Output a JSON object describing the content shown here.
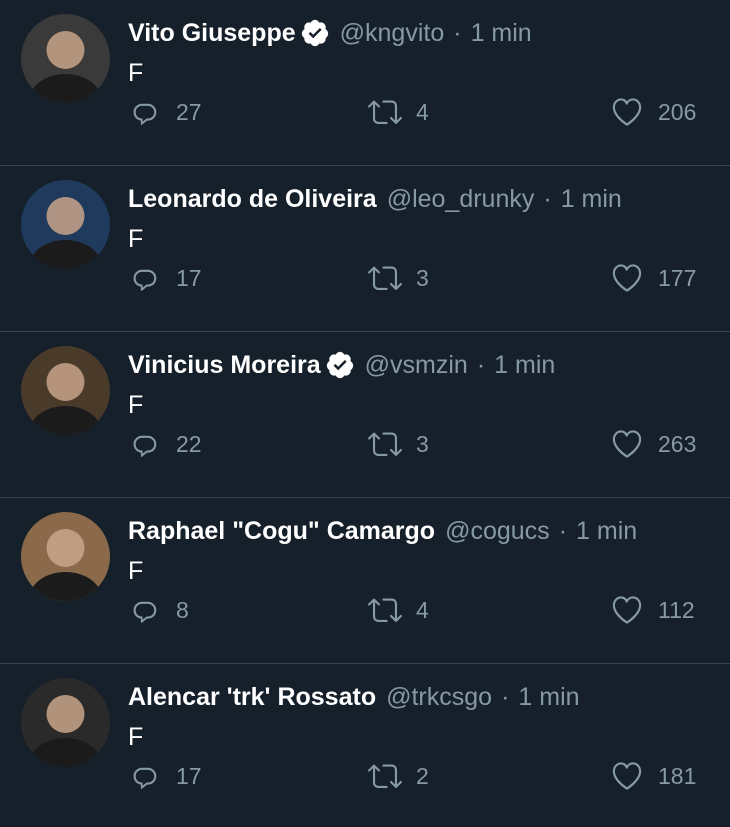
{
  "colors": {
    "background": "#15202b",
    "divider": "#38444d",
    "secondary_text": "#8899a6",
    "primary_text": "#ffffff"
  },
  "tweets": [
    {
      "display_name": "Vito Giuseppe",
      "verified": true,
      "handle": "@kngvito",
      "separator": "·",
      "time": "1 min",
      "text": "F",
      "replies": "27",
      "retweets": "4",
      "likes": "206",
      "avatar_tone": "#3a3a3a"
    },
    {
      "display_name": "Leonardo de Oliveira",
      "verified": false,
      "handle": "@leo_drunky",
      "separator": "·",
      "time": "1 min",
      "text": "F",
      "replies": "17",
      "retweets": "3",
      "likes": "177",
      "avatar_tone": "#1f3a5c"
    },
    {
      "display_name": "Vinicius Moreira",
      "verified": true,
      "handle": "@vsmzin",
      "separator": "·",
      "time": "1 min",
      "text": "F",
      "replies": "22",
      "retweets": "3",
      "likes": "263",
      "avatar_tone": "#4a3a2a"
    },
    {
      "display_name": "Raphael \"Cogu\" Camargo",
      "verified": false,
      "handle": "@cogucs",
      "separator": "·",
      "time": "1 min",
      "text": "F",
      "replies": "8",
      "retweets": "4",
      "likes": "112",
      "avatar_tone": "#8a6a4a"
    },
    {
      "display_name": "Alencar 'trk' Rossato",
      "verified": false,
      "handle": "@trkcsgo",
      "separator": "·",
      "time": "1 min",
      "text": "F",
      "replies": "17",
      "retweets": "2",
      "likes": "181",
      "avatar_tone": "#2a2a2a"
    }
  ]
}
